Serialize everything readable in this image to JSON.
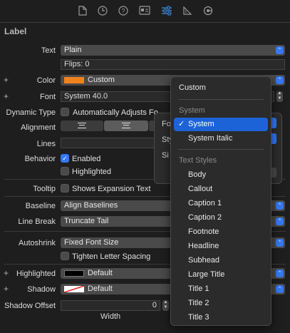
{
  "toolbar": {
    "icons": [
      "file-icon",
      "clock-icon",
      "help-icon",
      "identity-icon",
      "attributes-icon",
      "size-icon",
      "connections-icon"
    ]
  },
  "section": {
    "title": "Label"
  },
  "text": {
    "label": "Text",
    "value": "Plain",
    "field_value": "Flips: 0"
  },
  "color": {
    "label": "Color",
    "value": "Custom",
    "swatch": "#f0821e"
  },
  "font": {
    "label": "Font",
    "value": "System 40.0"
  },
  "dynamic_type": {
    "label": "Dynamic Type",
    "checkbox_label": "Automatically Adjusts Fo"
  },
  "alignment": {
    "label": "Alignment"
  },
  "lines": {
    "label": "Lines"
  },
  "behavior": {
    "label": "Behavior",
    "enabled": "Enabled",
    "highlighted": "Highlighted"
  },
  "tooltip": {
    "label": "Tooltip",
    "checkbox_label": "Shows Expansion Text"
  },
  "baseline": {
    "label": "Baseline",
    "value": "Align Baselines"
  },
  "line_break": {
    "label": "Line Break",
    "value": "Truncate Tail"
  },
  "autoshrink": {
    "label": "Autoshrink",
    "value": "Fixed Font Size",
    "tighten": "Tighten Letter Spacing"
  },
  "highlighted_color": {
    "label": "Highlighted",
    "value": "Default",
    "swatch": "#000000"
  },
  "shadow": {
    "label": "Shadow",
    "value": "Default"
  },
  "shadow_offset": {
    "label": "Shadow Offset",
    "width_value": "0",
    "width_caption": "Width"
  },
  "popover": {
    "row1": "Fo",
    "row2": "Sty",
    "row3": "Si"
  },
  "menu": {
    "custom": "Custom",
    "system_header": "System",
    "system": "System",
    "system_italic": "System Italic",
    "text_styles_header": "Text Styles",
    "styles": [
      "Body",
      "Callout",
      "Caption 1",
      "Caption 2",
      "Footnote",
      "Headline",
      "Subhead",
      "Large Title",
      "Title 1",
      "Title 2",
      "Title 3"
    ]
  },
  "colors": {
    "accent": "#3478f6",
    "selection": "#1d63d8",
    "background": "#1e1e1e"
  }
}
